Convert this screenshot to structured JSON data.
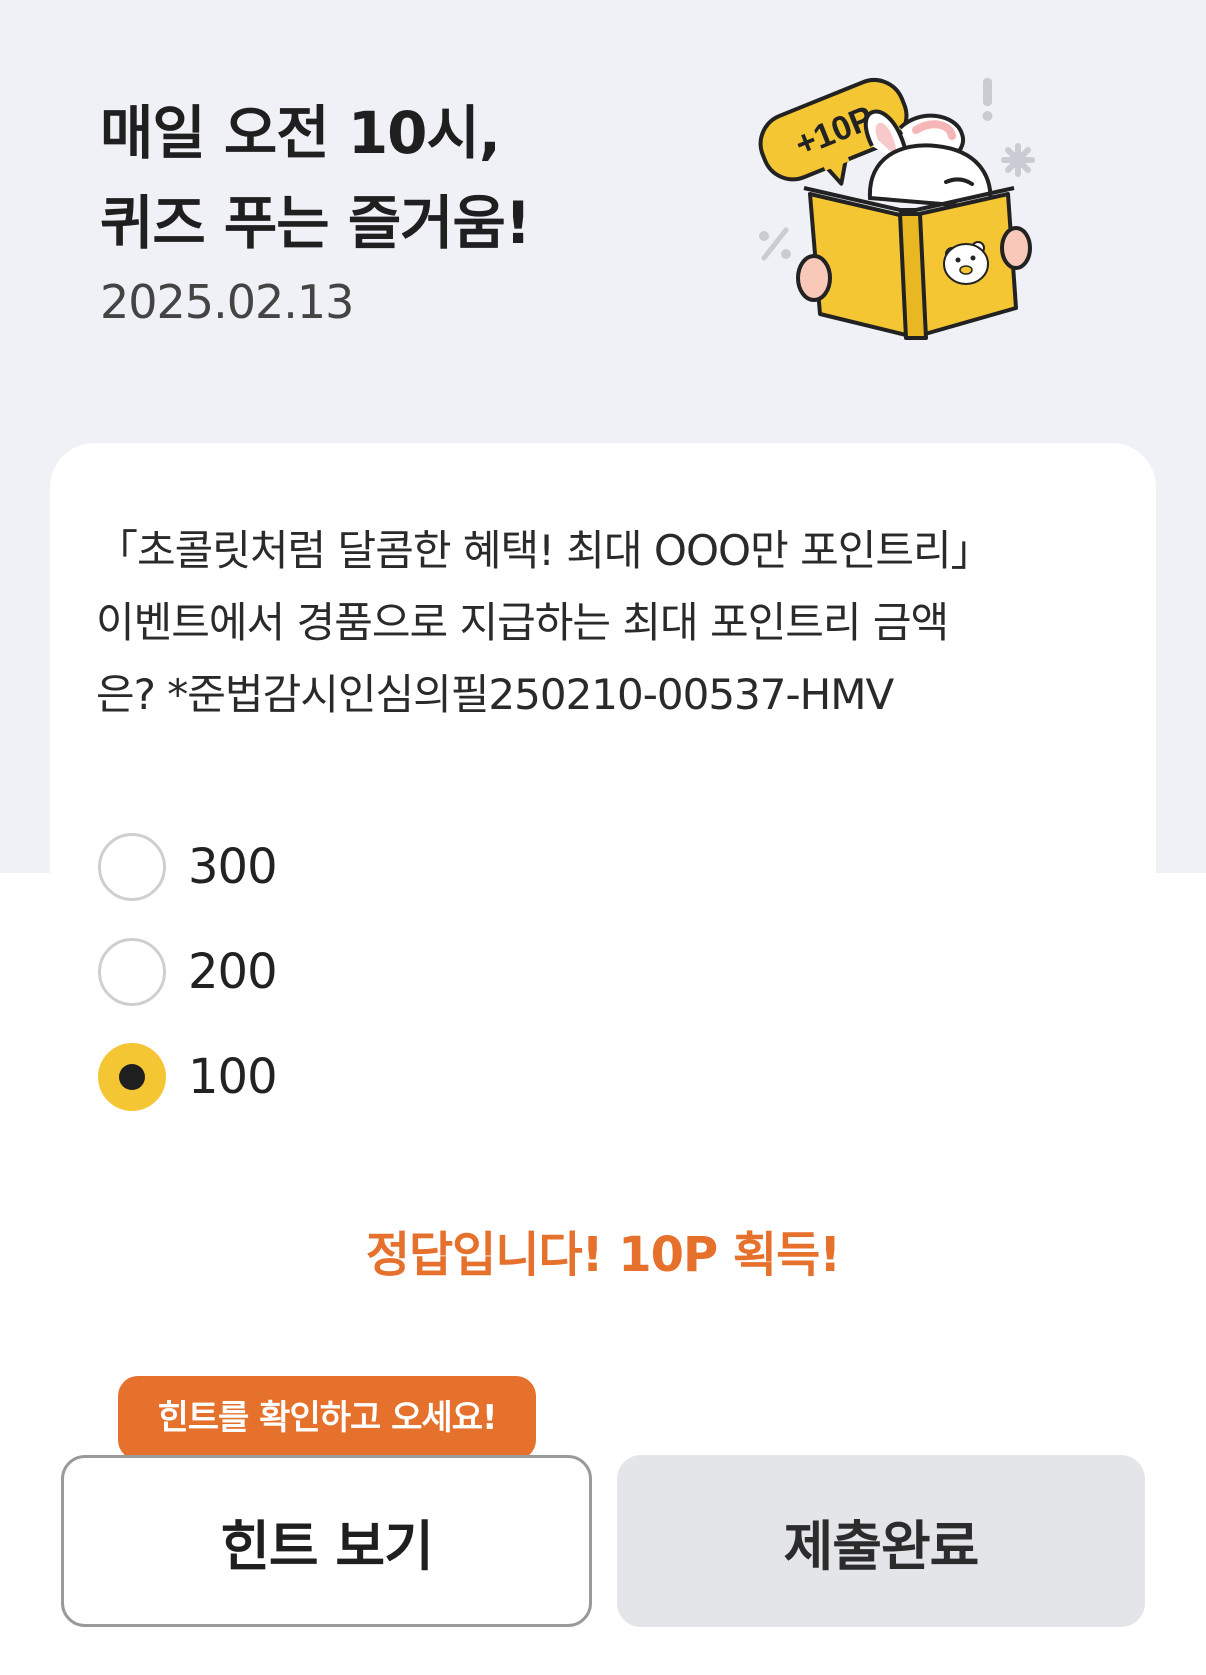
{
  "header": {
    "title_line1": "매일 오전 10시,",
    "title_line2": "퀴즈 푸는 즐거움!",
    "date": "2025.02.13",
    "badge_text": "+10P"
  },
  "quiz": {
    "question_line1": "「초콜릿처럼 달콤한 혜택! 최대 OOO만 포인트리」",
    "question_line2": "이벤트에서 경품으로 지급하는 최대 포인트리 금액",
    "question_line3": "은? *준법감시인심의필250210-00537-HMV",
    "options": [
      {
        "label": "300",
        "selected": false
      },
      {
        "label": "200",
        "selected": false
      },
      {
        "label": "100",
        "selected": true
      }
    ],
    "result_message": "정답입니다! 10P 획득!"
  },
  "tooltip": {
    "text": "힌트를 확인하고 오세요!"
  },
  "buttons": {
    "hint_label": "힌트 보기",
    "submit_label": "제출완료"
  },
  "colors": {
    "hero_background": "#eff1f6",
    "accent_orange": "#e6712c",
    "selected_yellow": "#f5c633",
    "submit_gray": "#e3e5e9"
  },
  "icons": {
    "mascot": "rabbit-reading-book-illustration",
    "radio_selected": "radio-selected-icon",
    "radio_unselected": "radio-unselected-icon"
  }
}
